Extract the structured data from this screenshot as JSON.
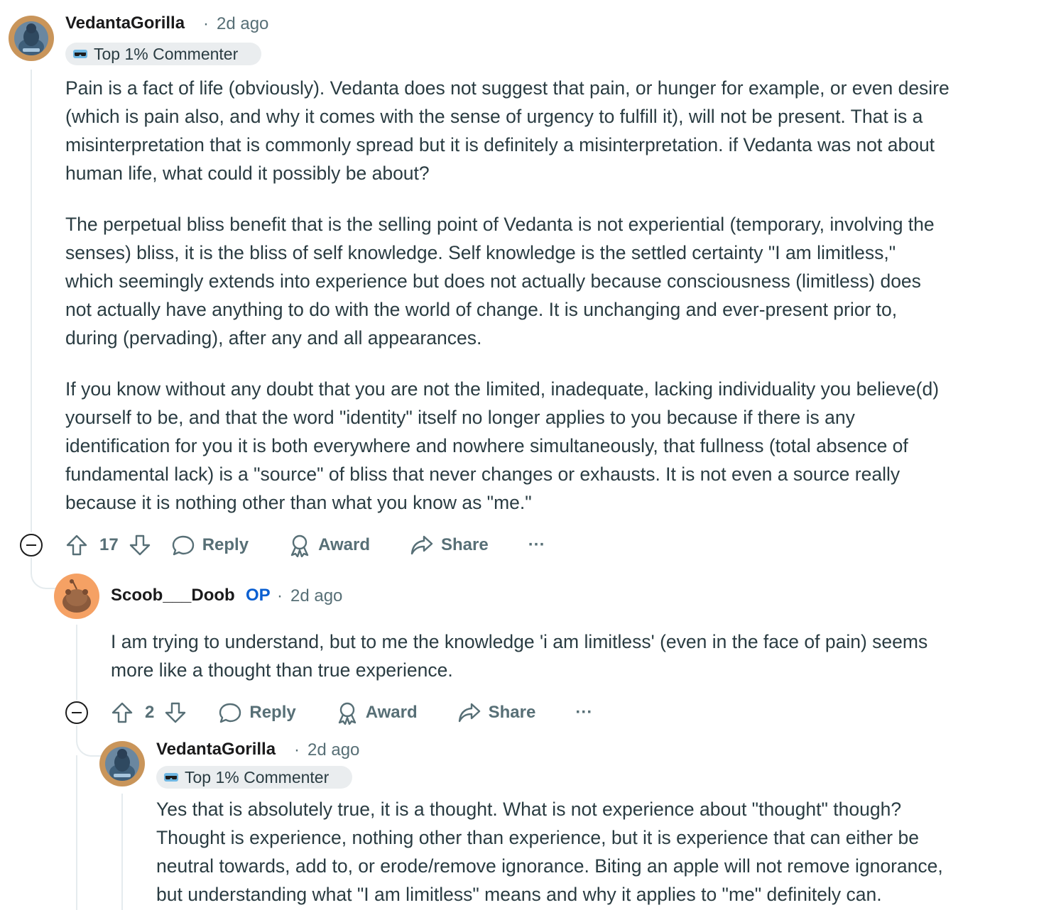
{
  "comments": [
    {
      "username": "VedantaGorilla",
      "separator": "·",
      "time": "2d ago",
      "badge": "Top 1% Commenter",
      "paragraphs": [
        [
          "Pain is a fact of life (obviously). Vedanta does not suggest that pain, or hunger for example, or even desire",
          "(which is pain also, and why it comes with the sense of urgency to fulfill it), will not be present. That is a",
          "misinterpretation that is commonly spread but it is definitely a misinterpretation. if Vedanta was not about",
          "human life, what could it possibly be about?"
        ],
        [
          "The perpetual bliss benefit that is the selling point of Vedanta is not experiential (temporary, involving the",
          "senses) bliss, it is the bliss of self knowledge. Self knowledge is the settled certainty \"I am limitless,\"",
          "which seemingly extends into experience but does not actually because consciousness (limitless) does",
          "not actually have anything to do with the world of change. It is unchanging and ever-present prior to,",
          "during (pervading), after any and all appearances."
        ],
        [
          "If you know without any doubt that you are not the limited, inadequate, lacking individuality you believe(d)",
          "yourself to be, and that the word \"identity\" itself no longer applies to you because if there is any",
          "identification for you it is both everywhere and nowhere simultaneously, that fullness (total absence of",
          "fundamental lack) is a \"source\" of bliss that never changes or exhausts. It is not even a source really",
          "because it is nothing other than what you know as \"me.\""
        ]
      ],
      "votes": "17",
      "reply_label": "Reply",
      "award_label": "Award",
      "share_label": "Share",
      "more_label": "···"
    },
    {
      "username": "Scoob___Doob",
      "op_label": "OP",
      "separator": "·",
      "time": "2d ago",
      "paragraphs": [
        [
          "I am trying to understand, but to me the knowledge 'i am limitless' (even in the face of pain) seems",
          "more like a thought than true experience."
        ]
      ],
      "votes": "2",
      "reply_label": "Reply",
      "award_label": "Award",
      "share_label": "Share",
      "more_label": "···"
    },
    {
      "username": "VedantaGorilla",
      "separator": "·",
      "time": "2d ago",
      "badge": "Top 1% Commenter",
      "paragraphs": [
        [
          "Yes that is absolutely true, it is a thought. What is not experience about \"thought\" though?",
          "Thought is experience, nothing other than experience, but it is experience that can either be",
          "neutral towards, add to, or erode/remove ignorance. Biting an apple will not remove ignorance,",
          "but understanding what \"I am limitless\" means and why it applies to \"me\" definitely can."
        ]
      ]
    }
  ],
  "colors": {
    "text": "#2a3c42",
    "meta": "#576f76",
    "op": "#0a5fd1",
    "badge_bg": "#eaedef",
    "thread_line": "#e5ebee"
  },
  "icons": [
    "gorilla-avatar",
    "snoo-avatar",
    "sunglasses-icon",
    "upvote-icon",
    "downvote-icon",
    "comment-icon",
    "award-icon",
    "share-icon",
    "collapse-icon"
  ]
}
